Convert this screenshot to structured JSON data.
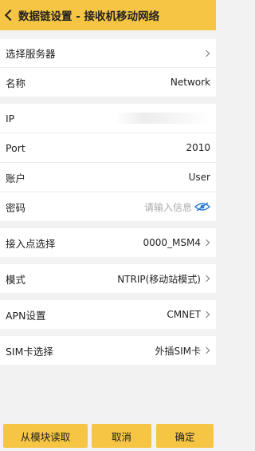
{
  "header": {
    "title": "数据链设置 - 接收机移动网络"
  },
  "server": {
    "label": "选择服务器"
  },
  "name": {
    "label": "名称",
    "value": "Network"
  },
  "ip": {
    "label": "IP"
  },
  "port": {
    "label": "Port",
    "value": "2010"
  },
  "account": {
    "label": "账户",
    "value": "User"
  },
  "password": {
    "label": "密码",
    "placeholder": "请输入信息"
  },
  "access_point": {
    "label": "接入点选择",
    "value": "0000_MSM4"
  },
  "mode": {
    "label": "模式",
    "value": "NTRIP(移动站模式)"
  },
  "apn": {
    "label": "APN设置",
    "value": "CMNET"
  },
  "sim": {
    "label": "SIM卡选择",
    "value": "外插SIM卡"
  },
  "buttons": {
    "read": "从模块读取",
    "cancel": "取消",
    "confirm": "确定"
  },
  "colors": {
    "accent": "#f5c543",
    "eye_icon": "#2a7bd6"
  },
  "icons": [
    "back-arrow-icon",
    "chevron-right-icon",
    "eye-off-icon"
  ]
}
